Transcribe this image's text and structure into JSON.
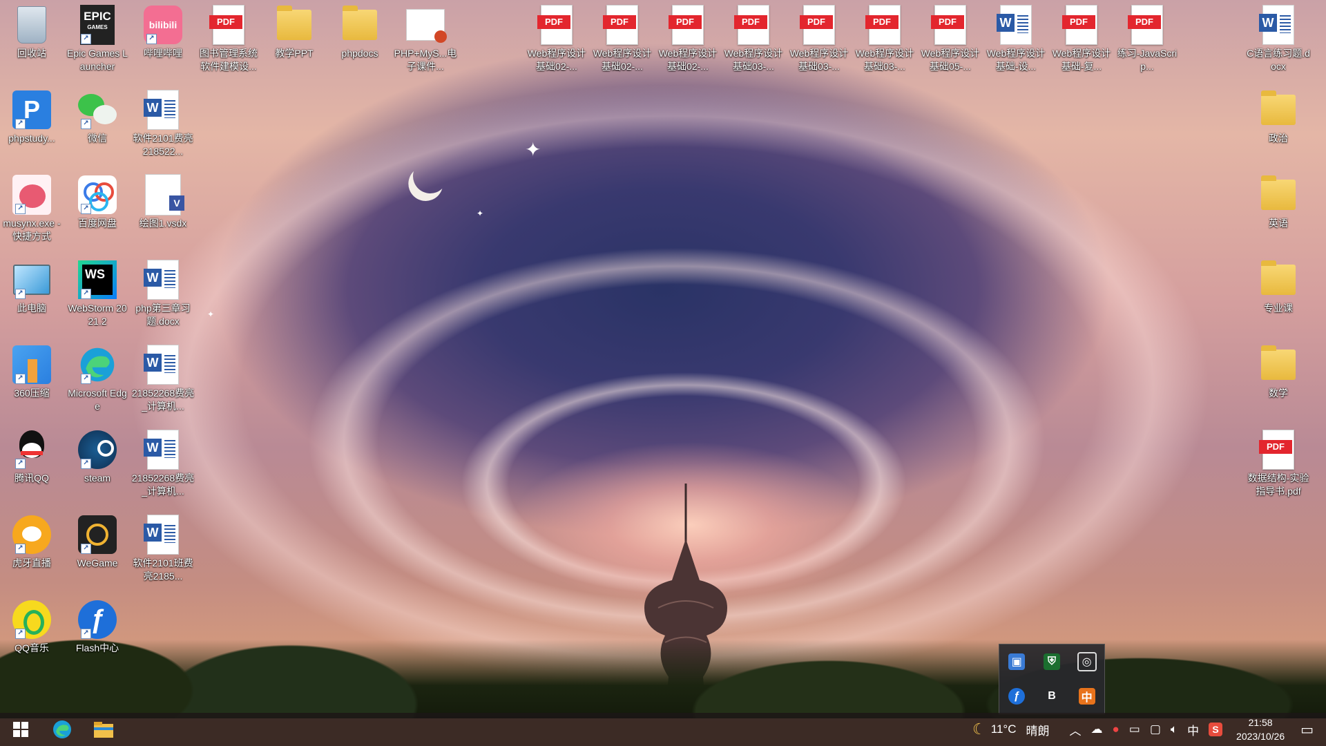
{
  "desktop_left": [
    {
      "label": "回收站",
      "icon": "recycle-bin-icon"
    },
    {
      "label": "Epic Games Launcher",
      "icon": "epic-games-icon"
    },
    {
      "label": "哔哩哔哩",
      "icon": "bilibili-icon"
    },
    {
      "label": "图书管理系统软件建模设...",
      "icon": "pdf-icon"
    },
    {
      "label": "教学PPT",
      "icon": "folder-icon"
    },
    {
      "label": "phpdocs",
      "icon": "folder-icon"
    },
    {
      "label": "PHP+MyS...电子课件...",
      "icon": "ppt-icon"
    },
    {
      "label": "phpstudy...",
      "icon": "phpstudy-icon"
    },
    {
      "label": "微信",
      "icon": "wechat-icon"
    },
    {
      "label": "软件2101费亮218522...",
      "icon": "word-icon"
    },
    {
      "label": "musynx.exe - 快捷方式",
      "icon": "musynx-icon"
    },
    {
      "label": "百度网盘",
      "icon": "baidu-netdisk-icon"
    },
    {
      "label": "绘图1.vsdx",
      "icon": "visio-icon"
    },
    {
      "label": "此电脑",
      "icon": "this-pc-icon"
    },
    {
      "label": "WebStorm 2021.2",
      "icon": "webstorm-icon"
    },
    {
      "label": "php第三章习题.docx",
      "icon": "word-icon"
    },
    {
      "label": "360压缩",
      "icon": "zip-icon"
    },
    {
      "label": "Microsoft Edge",
      "icon": "edge-icon"
    },
    {
      "label": "21852268费亮_计算机...",
      "icon": "word-icon"
    },
    {
      "label": "腾讯QQ",
      "icon": "qq-icon"
    },
    {
      "label": "steam",
      "icon": "steam-icon"
    },
    {
      "label": "21852268费亮_计算机...",
      "icon": "word-icon"
    },
    {
      "label": "虎牙直播",
      "icon": "huya-icon"
    },
    {
      "label": "WeGame",
      "icon": "wegame-icon"
    },
    {
      "label": "软件2101班费亮2185...",
      "icon": "word-icon"
    },
    {
      "label": "QQ音乐",
      "icon": "qqmusic-icon"
    },
    {
      "label": "Flash中心",
      "icon": "flash-icon"
    }
  ],
  "desktop_top": [
    {
      "label": "Web程序设计基础02-...",
      "icon": "pdf-icon"
    },
    {
      "label": "Web程序设计基础02-...",
      "icon": "pdf-icon"
    },
    {
      "label": "Web程序设计基础02-...",
      "icon": "pdf-icon"
    },
    {
      "label": "Web程序设计基础03-...",
      "icon": "pdf-icon"
    },
    {
      "label": "Web程序设计基础03-...",
      "icon": "pdf-icon"
    },
    {
      "label": "Web程序设计基础03-...",
      "icon": "pdf-icon"
    },
    {
      "label": "Web程序设计基础05-...",
      "icon": "pdf-icon"
    },
    {
      "label": "Web程序设计基础-设...",
      "icon": "word-icon"
    },
    {
      "label": "Web程序设计基础-复...",
      "icon": "pdf-icon"
    },
    {
      "label": "练习-JavaScrip...",
      "icon": "pdf-icon"
    }
  ],
  "desktop_right": [
    {
      "label": "C语言练习题.docx",
      "icon": "word-icon"
    },
    {
      "label": "政治",
      "icon": "folder-icon"
    },
    {
      "label": "英语",
      "icon": "folder-icon"
    },
    {
      "label": "专业课",
      "icon": "folder-icon"
    },
    {
      "label": "数学",
      "icon": "folder-icon"
    },
    {
      "label": "数据结构-实验指导书.pdf",
      "icon": "pdf-icon"
    }
  ],
  "labels": {
    "pdf": "PDF",
    "word": "W",
    "epic": "EPIC",
    "epic_sub": "GAMES",
    "bili": "bilibili",
    "ws": "WS",
    "ime_zh": "中",
    "tb_sogou": "S",
    "tray_b": "B",
    "tray_zh": "中"
  },
  "taskbar": {
    "weather_temp": "11°C",
    "weather_text": "晴朗",
    "ime": "中",
    "time": "21:58",
    "date": "2023/10/26"
  },
  "colors": {
    "taskbar_bg": "#1c1616",
    "pdf_red": "#e3262e",
    "word_blue": "#2b5aa6"
  }
}
